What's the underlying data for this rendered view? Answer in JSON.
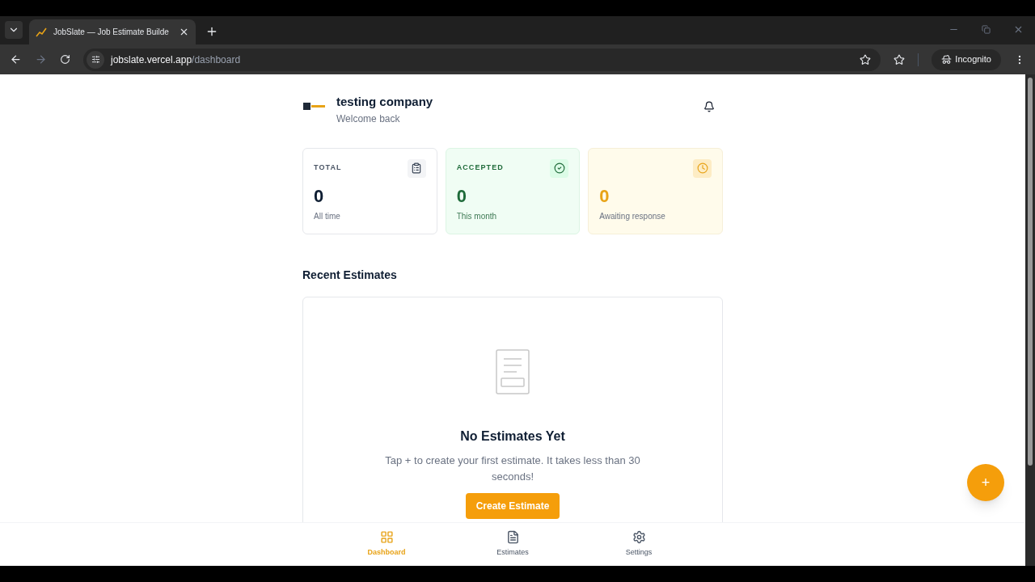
{
  "browser": {
    "tab_title": "JobSlate — Job Estimate Builde",
    "url_host": "jobslate.vercel.app",
    "url_path": "/dashboard",
    "profile": "Incognito"
  },
  "header": {
    "company": "testing company",
    "greeting": "Welcome back"
  },
  "stats": [
    {
      "kind": "total",
      "label": "TOTAL",
      "value": "0",
      "caption": "All time"
    },
    {
      "kind": "accepted",
      "label": "ACCEPTED",
      "value": "0",
      "caption": "This month"
    },
    {
      "kind": "pending",
      "value": "0",
      "caption": "Awaiting response"
    }
  ],
  "recent": {
    "title": "Recent Estimates",
    "empty_title": "No Estimates Yet",
    "empty_text": "Tap + to create your first estimate. It takes less than 30 seconds!",
    "button": "Create Estimate"
  },
  "fab": "+",
  "nav": [
    {
      "kind": "dashboard",
      "label": "Dashboard",
      "selected": true
    },
    {
      "kind": "estimates",
      "label": "Estimates",
      "selected": false
    },
    {
      "kind": "settings",
      "label": "Settings",
      "selected": false
    }
  ]
}
